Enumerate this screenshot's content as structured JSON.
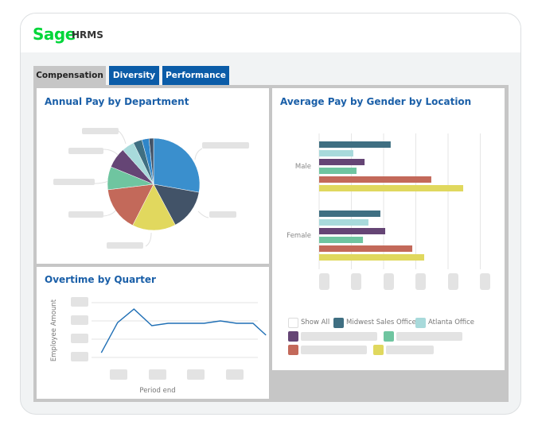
{
  "app": {
    "logo": "Sage",
    "name": "HRMS",
    "brand_color": "#00d639"
  },
  "tabs": [
    {
      "label": "Compensation",
      "active": true
    },
    {
      "label": "Diversity",
      "active": false
    },
    {
      "label": "Performance",
      "active": false
    }
  ],
  "panels": {
    "annual_pay": {
      "title": "Annual Pay by Department"
    },
    "avg_pay": {
      "title": "Average Pay by Gender by Location"
    },
    "overtime": {
      "title": "Overtime by Quarter"
    }
  },
  "chart_data": [
    {
      "type": "pie",
      "title": "Annual Pay by Department",
      "labels_hidden": true,
      "slices": [
        {
          "value": 27.8,
          "color": "#3a8fcd"
        },
        {
          "value": 14.4,
          "color": "#425368"
        },
        {
          "value": 15.3,
          "color": "#e1d85e"
        },
        {
          "value": 15.6,
          "color": "#c3695a"
        },
        {
          "value": 8.1,
          "color": "#6fc5a0"
        },
        {
          "value": 7.2,
          "color": "#654575"
        },
        {
          "value": 4.4,
          "color": "#a8dadb"
        },
        {
          "value": 3.1,
          "color": "#3f6f82"
        },
        {
          "value": 2.5,
          "color": "#2f86c9"
        },
        {
          "value": 1.6,
          "color": "#425368"
        }
      ]
    },
    {
      "type": "bar",
      "orientation": "horizontal",
      "title": "Average Pay by Gender by Location",
      "categories": [
        "Male",
        "Female"
      ],
      "xlim": [
        0,
        5
      ],
      "x_tick_labels_hidden": true,
      "series": [
        {
          "name": "Midwest Sales Office",
          "color": "#3f6f82",
          "values": [
            2.22,
            1.9
          ]
        },
        {
          "name": "Atlanta Office",
          "color": "#a8dadb",
          "values": [
            1.06,
            1.53
          ]
        },
        {
          "name": "",
          "color": "#654575",
          "values": [
            1.41,
            2.05
          ]
        },
        {
          "name": "",
          "color": "#6fc5a0",
          "values": [
            1.16,
            1.36
          ]
        },
        {
          "name": "",
          "color": "#c3695a",
          "values": [
            3.48,
            2.89
          ]
        },
        {
          "name": "",
          "color": "#e0d85e",
          "values": [
            4.47,
            3.26
          ]
        }
      ],
      "legend": {
        "show_all_label": "Show All",
        "placement": "bottom"
      }
    },
    {
      "type": "line",
      "title": "Overtime by Quarter",
      "xlabel": "Period end",
      "ylabel": "Employee Amount",
      "ylim": [
        0,
        3
      ],
      "tick_labels_hidden": true,
      "color": "#1f6fb5",
      "x": [
        0,
        1,
        2,
        3,
        4,
        5,
        6,
        7,
        8,
        9
      ],
      "xlim": [
        0,
        10.2
      ],
      "x_positions": [
        0.6,
        1.6,
        2.6,
        3.7,
        4.7,
        6.9,
        7.9,
        8.9,
        9.9,
        10.7
      ],
      "values": [
        0.26,
        1.91,
        2.65,
        1.74,
        1.87,
        1.87,
        2.0,
        1.87,
        1.87,
        1.22
      ]
    }
  ]
}
